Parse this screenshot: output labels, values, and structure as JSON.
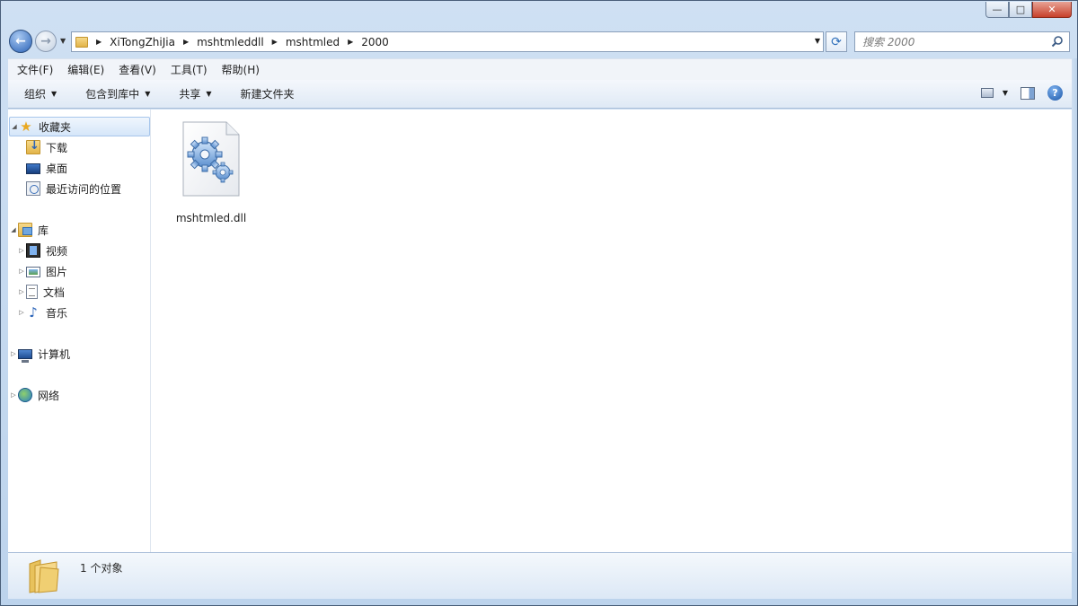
{
  "window": {
    "controls": {
      "minimize": "—",
      "maximize": "□",
      "close": "✕"
    }
  },
  "nav": {
    "back_icon": "back-arrow-icon",
    "forward_icon": "forward-arrow-icon",
    "breadcrumb": [
      "XiTongZhiJia",
      "mshtmleddll",
      "mshtmled",
      "2000"
    ],
    "search_placeholder": "搜索 2000"
  },
  "menubar": {
    "items": [
      "文件(F)",
      "编辑(E)",
      "查看(V)",
      "工具(T)",
      "帮助(H)"
    ]
  },
  "cmdbar": {
    "organize": "组织",
    "include_library": "包含到库中",
    "share": "共享",
    "new_folder": "新建文件夹"
  },
  "navpane": {
    "favorites": {
      "label": "收藏夹",
      "items": [
        "下载",
        "桌面",
        "最近访问的位置"
      ]
    },
    "libraries": {
      "label": "库",
      "items": [
        "视频",
        "图片",
        "文档",
        "音乐"
      ]
    },
    "computer": "计算机",
    "network": "网络"
  },
  "content": {
    "files": [
      {
        "name": "mshtmled.dll",
        "icon": "dll-gear-icon"
      }
    ]
  },
  "details": {
    "summary": "1 个对象"
  },
  "colors": {
    "window_frame": "#bcd3ec",
    "selected_bg": "#d5e6f9",
    "folder_yellow": "#e2b449",
    "accent_blue": "#2a63b8"
  }
}
